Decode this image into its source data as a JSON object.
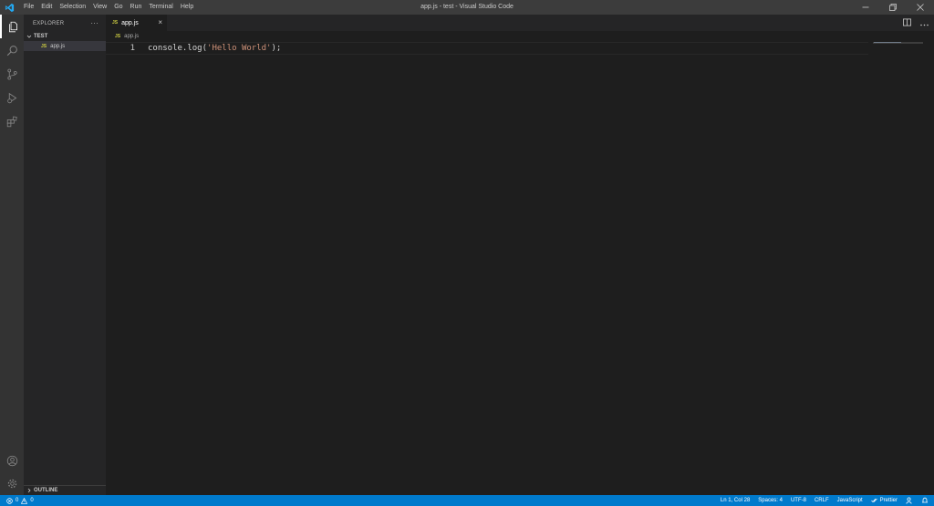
{
  "window": {
    "title": "app.js - test - Visual Studio Code",
    "menu": [
      "File",
      "Edit",
      "Selection",
      "View",
      "Go",
      "Run",
      "Terminal",
      "Help"
    ]
  },
  "sidebar": {
    "header": "EXPLORER",
    "more_label": "···",
    "folder_name": "TEST",
    "files": [
      {
        "badge": "JS",
        "name": "app.js"
      }
    ],
    "outline_label": "OUTLINE"
  },
  "tab": {
    "badge": "JS",
    "name": "app.js",
    "close_label": "×"
  },
  "breadcrumb": {
    "badge": "JS",
    "name": "app.js"
  },
  "editor": {
    "line_number": "1",
    "code_prefix": "console.log(",
    "code_string": "'Hello World'",
    "code_suffix": ");"
  },
  "statusbar": {
    "errors": "0",
    "warnings": "0",
    "position": "Ln 1, Col 28",
    "spaces": "Spaces: 4",
    "encoding": "UTF-8",
    "eol": "CRLF",
    "language": "JavaScript",
    "prettier": "Prettier"
  },
  "colors": {
    "accent": "#007acc",
    "titlebar": "#3c3c3c",
    "activitybar": "#333333",
    "sidebar": "#252526",
    "editor": "#1e1e1e",
    "js_badge": "#cbcb41",
    "string": "#ce9178"
  }
}
